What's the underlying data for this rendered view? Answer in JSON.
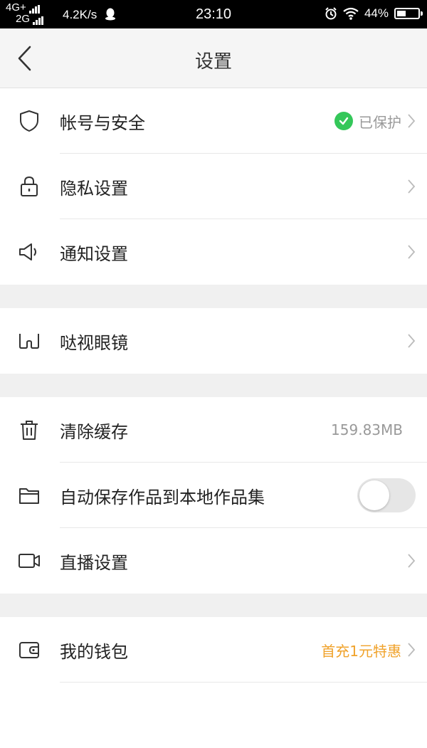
{
  "status_bar": {
    "network_top": "4G+",
    "network_bottom": "2G",
    "speed": "4.2K/s",
    "time": "23:10",
    "battery": "44%",
    "battery_level": 0.44
  },
  "header": {
    "title": "设置"
  },
  "groups": [
    {
      "items": [
        {
          "label": "帐号与安全",
          "value": "已保护",
          "icon": "shield-icon"
        },
        {
          "label": "隐私设置",
          "icon": "lock-icon"
        },
        {
          "label": "通知设置",
          "icon": "speaker-icon"
        }
      ]
    },
    {
      "items": [
        {
          "label": "哒视眼镜",
          "icon": "glasses-icon"
        }
      ]
    },
    {
      "items": [
        {
          "label": "清除缓存",
          "value": "159.83MB",
          "icon": "trash-icon"
        },
        {
          "label": "自动保存作品到本地作品集",
          "toggle": false,
          "icon": "folder-icon"
        },
        {
          "label": "直播设置",
          "icon": "video-camera-icon"
        }
      ]
    },
    {
      "items": [
        {
          "label": "我的钱包",
          "value": "首充1元特惠",
          "icon": "wallet-icon"
        }
      ]
    }
  ],
  "colors": {
    "status_ok": "#34c759",
    "promo": "#f0a22a",
    "background": "#f0f0f0"
  }
}
